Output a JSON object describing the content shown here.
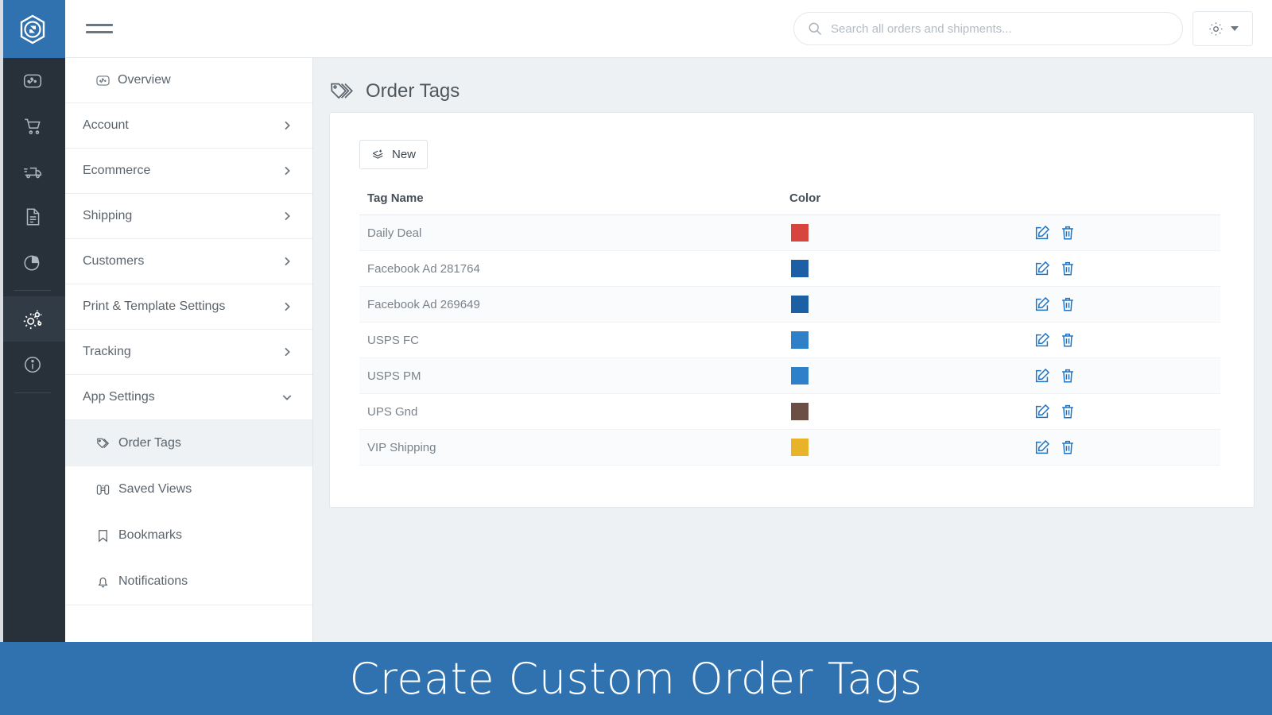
{
  "brand": {
    "logo_icon": "hexagon-s-logo",
    "accent_color": "#2f72af",
    "rail_color": "#28313a"
  },
  "topbar": {
    "menu_toggle_icon": "hamburger-icon",
    "search": {
      "icon": "search-icon",
      "placeholder": "Search all orders and shipments...",
      "value": ""
    },
    "settings_button": {
      "icon": "gear-icon",
      "caret_icon": "chevron-down-icon"
    }
  },
  "rail": {
    "items": [
      {
        "icon": "gauge-dashboard-icon",
        "active": false
      },
      {
        "icon": "shopping-cart-icon",
        "active": false
      },
      {
        "icon": "delivery-truck-icon",
        "active": false
      },
      {
        "icon": "document-icon",
        "active": false
      },
      {
        "icon": "pie-chart-icon",
        "active": false
      },
      {
        "icon": "gears-settings-icon",
        "active": true
      },
      {
        "icon": "info-circle-icon",
        "active": false
      }
    ]
  },
  "menu": {
    "overview": {
      "label": "Overview",
      "icon": "gauge-icon"
    },
    "groups": [
      {
        "label": "Account",
        "chevron": "chevron-right-icon",
        "expanded": false
      },
      {
        "label": "Ecommerce",
        "chevron": "chevron-right-icon",
        "expanded": false
      },
      {
        "label": "Shipping",
        "chevron": "chevron-right-icon",
        "expanded": false
      },
      {
        "label": "Customers",
        "chevron": "chevron-right-icon",
        "expanded": false
      },
      {
        "label": "Print & Template Settings",
        "chevron": "chevron-right-icon",
        "expanded": false
      },
      {
        "label": "Tracking",
        "chevron": "chevron-right-icon",
        "expanded": false
      },
      {
        "label": "App Settings",
        "chevron": "chevron-down-icon",
        "expanded": true
      }
    ],
    "sub_items": [
      {
        "label": "Order Tags",
        "icon": "tag-icon",
        "active": true
      },
      {
        "label": "Saved Views",
        "icon": "binoculars-icon",
        "active": false
      },
      {
        "label": "Bookmarks",
        "icon": "bookmark-icon",
        "active": false
      },
      {
        "label": "Notifications",
        "icon": "bell-icon",
        "active": false
      }
    ]
  },
  "page": {
    "icon": "tags-icon",
    "title": "Order Tags",
    "new_button": {
      "label": "New",
      "icon": "layers-plus-icon"
    },
    "table": {
      "columns": [
        "Tag Name",
        "Color",
        ""
      ],
      "row_action_icons": [
        "edit-pencil-icon",
        "trash-delete-icon"
      ],
      "action_icon_color": "#1b73c4",
      "rows": [
        {
          "name": "Daily Deal",
          "color": "#d8453f"
        },
        {
          "name": "Facebook Ad 281764",
          "color": "#1d5fa4"
        },
        {
          "name": "Facebook Ad 269649",
          "color": "#1d5fa4"
        },
        {
          "name": "USPS FC",
          "color": "#2e80c8"
        },
        {
          "name": "USPS PM",
          "color": "#2e80c8"
        },
        {
          "name": "UPS Gnd",
          "color": "#6b4f45"
        },
        {
          "name": "VIP Shipping",
          "color": "#e8b229"
        }
      ]
    }
  },
  "banner": {
    "text": "Create Custom Order Tags",
    "background": "#2f72af"
  }
}
